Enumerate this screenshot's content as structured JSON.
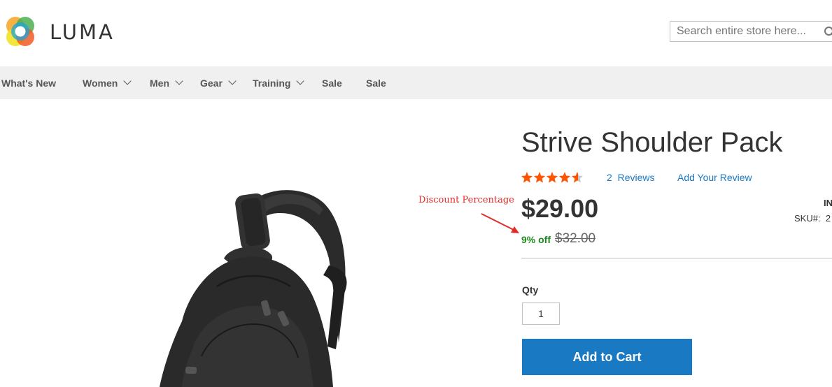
{
  "header": {
    "logo_text": "LUMA",
    "search_placeholder": "Search entire store here..."
  },
  "nav": {
    "items": [
      {
        "label": "What's New",
        "has_dropdown": false
      },
      {
        "label": "Women",
        "has_dropdown": true
      },
      {
        "label": "Men",
        "has_dropdown": true
      },
      {
        "label": "Gear",
        "has_dropdown": true
      },
      {
        "label": "Training",
        "has_dropdown": true
      },
      {
        "label": "Sale",
        "has_dropdown": false
      },
      {
        "label": "Sale",
        "has_dropdown": false
      }
    ]
  },
  "product": {
    "title": "Strive Shoulder Pack",
    "rating_fraction": 0.9,
    "reviews_count": "2",
    "reviews_label": "Reviews",
    "add_review_label": "Add Your Review",
    "price": "$29.00",
    "discount": "9% off",
    "old_price": "$32.00",
    "stock_label": "IN",
    "sku_label": "SKU#:",
    "sku_value": "2"
  },
  "annotation": {
    "label": "Discount Percentage"
  },
  "qty": {
    "label": "Qty",
    "value": "1"
  },
  "cart": {
    "button_label": "Add to Cart"
  },
  "colors": {
    "accent": "#1979c3",
    "star": "#ff5501",
    "discount": "#1c8a1c",
    "annotation": "#e02b27",
    "nav_bg": "#f0f0f0"
  },
  "icons": {
    "search": "search-icon",
    "chevron": "chevron-down-icon",
    "logo": "luma-logo-icon"
  }
}
